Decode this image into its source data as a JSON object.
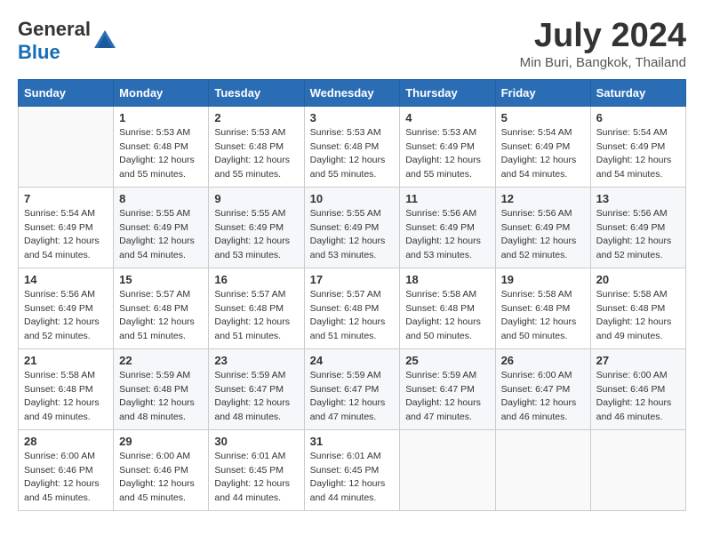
{
  "header": {
    "logo_general": "General",
    "logo_blue": "Blue",
    "title": "July 2024",
    "location": "Min Buri, Bangkok, Thailand"
  },
  "calendar": {
    "days_of_week": [
      "Sunday",
      "Monday",
      "Tuesday",
      "Wednesday",
      "Thursday",
      "Friday",
      "Saturday"
    ],
    "weeks": [
      [
        {
          "day": "",
          "info": ""
        },
        {
          "day": "1",
          "info": "Sunrise: 5:53 AM\nSunset: 6:48 PM\nDaylight: 12 hours\nand 55 minutes."
        },
        {
          "day": "2",
          "info": "Sunrise: 5:53 AM\nSunset: 6:48 PM\nDaylight: 12 hours\nand 55 minutes."
        },
        {
          "day": "3",
          "info": "Sunrise: 5:53 AM\nSunset: 6:48 PM\nDaylight: 12 hours\nand 55 minutes."
        },
        {
          "day": "4",
          "info": "Sunrise: 5:53 AM\nSunset: 6:49 PM\nDaylight: 12 hours\nand 55 minutes."
        },
        {
          "day": "5",
          "info": "Sunrise: 5:54 AM\nSunset: 6:49 PM\nDaylight: 12 hours\nand 54 minutes."
        },
        {
          "day": "6",
          "info": "Sunrise: 5:54 AM\nSunset: 6:49 PM\nDaylight: 12 hours\nand 54 minutes."
        }
      ],
      [
        {
          "day": "7",
          "info": "Sunrise: 5:54 AM\nSunset: 6:49 PM\nDaylight: 12 hours\nand 54 minutes."
        },
        {
          "day": "8",
          "info": "Sunrise: 5:55 AM\nSunset: 6:49 PM\nDaylight: 12 hours\nand 54 minutes."
        },
        {
          "day": "9",
          "info": "Sunrise: 5:55 AM\nSunset: 6:49 PM\nDaylight: 12 hours\nand 53 minutes."
        },
        {
          "day": "10",
          "info": "Sunrise: 5:55 AM\nSunset: 6:49 PM\nDaylight: 12 hours\nand 53 minutes."
        },
        {
          "day": "11",
          "info": "Sunrise: 5:56 AM\nSunset: 6:49 PM\nDaylight: 12 hours\nand 53 minutes."
        },
        {
          "day": "12",
          "info": "Sunrise: 5:56 AM\nSunset: 6:49 PM\nDaylight: 12 hours\nand 52 minutes."
        },
        {
          "day": "13",
          "info": "Sunrise: 5:56 AM\nSunset: 6:49 PM\nDaylight: 12 hours\nand 52 minutes."
        }
      ],
      [
        {
          "day": "14",
          "info": "Sunrise: 5:56 AM\nSunset: 6:49 PM\nDaylight: 12 hours\nand 52 minutes."
        },
        {
          "day": "15",
          "info": "Sunrise: 5:57 AM\nSunset: 6:48 PM\nDaylight: 12 hours\nand 51 minutes."
        },
        {
          "day": "16",
          "info": "Sunrise: 5:57 AM\nSunset: 6:48 PM\nDaylight: 12 hours\nand 51 minutes."
        },
        {
          "day": "17",
          "info": "Sunrise: 5:57 AM\nSunset: 6:48 PM\nDaylight: 12 hours\nand 51 minutes."
        },
        {
          "day": "18",
          "info": "Sunrise: 5:58 AM\nSunset: 6:48 PM\nDaylight: 12 hours\nand 50 minutes."
        },
        {
          "day": "19",
          "info": "Sunrise: 5:58 AM\nSunset: 6:48 PM\nDaylight: 12 hours\nand 50 minutes."
        },
        {
          "day": "20",
          "info": "Sunrise: 5:58 AM\nSunset: 6:48 PM\nDaylight: 12 hours\nand 49 minutes."
        }
      ],
      [
        {
          "day": "21",
          "info": "Sunrise: 5:58 AM\nSunset: 6:48 PM\nDaylight: 12 hours\nand 49 minutes."
        },
        {
          "day": "22",
          "info": "Sunrise: 5:59 AM\nSunset: 6:48 PM\nDaylight: 12 hours\nand 48 minutes."
        },
        {
          "day": "23",
          "info": "Sunrise: 5:59 AM\nSunset: 6:47 PM\nDaylight: 12 hours\nand 48 minutes."
        },
        {
          "day": "24",
          "info": "Sunrise: 5:59 AM\nSunset: 6:47 PM\nDaylight: 12 hours\nand 47 minutes."
        },
        {
          "day": "25",
          "info": "Sunrise: 5:59 AM\nSunset: 6:47 PM\nDaylight: 12 hours\nand 47 minutes."
        },
        {
          "day": "26",
          "info": "Sunrise: 6:00 AM\nSunset: 6:47 PM\nDaylight: 12 hours\nand 46 minutes."
        },
        {
          "day": "27",
          "info": "Sunrise: 6:00 AM\nSunset: 6:46 PM\nDaylight: 12 hours\nand 46 minutes."
        }
      ],
      [
        {
          "day": "28",
          "info": "Sunrise: 6:00 AM\nSunset: 6:46 PM\nDaylight: 12 hours\nand 45 minutes."
        },
        {
          "day": "29",
          "info": "Sunrise: 6:00 AM\nSunset: 6:46 PM\nDaylight: 12 hours\nand 45 minutes."
        },
        {
          "day": "30",
          "info": "Sunrise: 6:01 AM\nSunset: 6:45 PM\nDaylight: 12 hours\nand 44 minutes."
        },
        {
          "day": "31",
          "info": "Sunrise: 6:01 AM\nSunset: 6:45 PM\nDaylight: 12 hours\nand 44 minutes."
        },
        {
          "day": "",
          "info": ""
        },
        {
          "day": "",
          "info": ""
        },
        {
          "day": "",
          "info": ""
        }
      ]
    ]
  }
}
